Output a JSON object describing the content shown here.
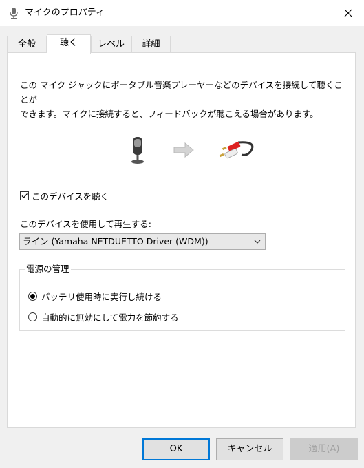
{
  "window": {
    "title": "マイクのプロパティ"
  },
  "tabs": [
    {
      "label": "全般",
      "active": false
    },
    {
      "label": "聴く",
      "active": true
    },
    {
      "label": "レベル",
      "active": false
    },
    {
      "label": "詳細",
      "active": false
    }
  ],
  "listen": {
    "description_line1": "この マイク ジャックにポータブル音楽プレーヤーなどのデバイスを接続して聴くことが",
    "description_line2": "できます。マイクに接続すると、フィードバックが聴こえる場合があります。",
    "listen_checkbox_label": "このデバイスを聴く",
    "listen_checked": true,
    "playback_label": "このデバイスを使用して再生する:",
    "playback_device": "ライン (Yamaha NETDUETTO Driver (WDM))"
  },
  "power": {
    "group_title": "電源の管理",
    "option1": "バッテリ使用時に実行し続ける",
    "option2": "自動的に無効にして電力を節約する",
    "selected": 1
  },
  "buttons": {
    "ok": "OK",
    "cancel": "キャンセル",
    "apply": "適用(A)"
  },
  "colors": {
    "accent": "#0078d7",
    "background": "#f0f0f0"
  }
}
